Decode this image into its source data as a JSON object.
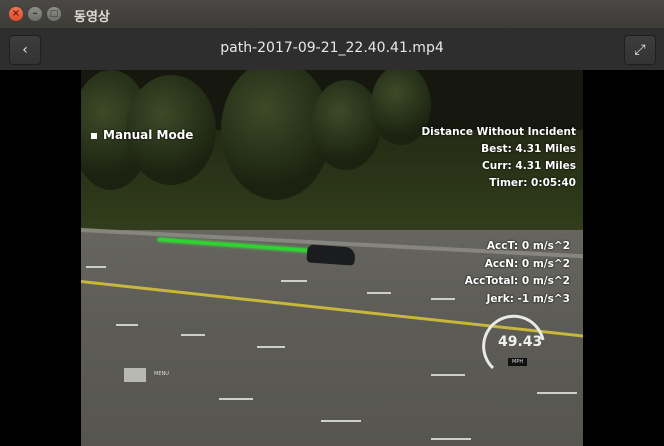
{
  "window": {
    "title": "동영상",
    "close_glyph": "×",
    "minimize_glyph": "–",
    "maximize_glyph": "□"
  },
  "header": {
    "back_icon": "chevron-left-icon",
    "back_glyph": "‹",
    "filename": "path-2017-09-21_22.40.41.mp4",
    "fullscreen_icon": "fullscreen-icon",
    "fullscreen_glyph": "⤢"
  },
  "video": {
    "mode_label": "Manual Mode",
    "stats": {
      "heading": "Distance Without Incident",
      "best": "Best: 4.31 Miles",
      "curr": "Curr: 4.31 Miles",
      "timer": "Timer: 0:05:40"
    },
    "accel": {
      "acct": "AccT: 0 m/s^2",
      "accn": "AccN: 0 m/s^2",
      "acctotal": "AccTotal: 0 m/s^2",
      "jerk": "Jerk: -1 m/s^3"
    },
    "speedometer": {
      "speed": "49.43",
      "unit": "MPH"
    },
    "menu_label": "MENU"
  }
}
